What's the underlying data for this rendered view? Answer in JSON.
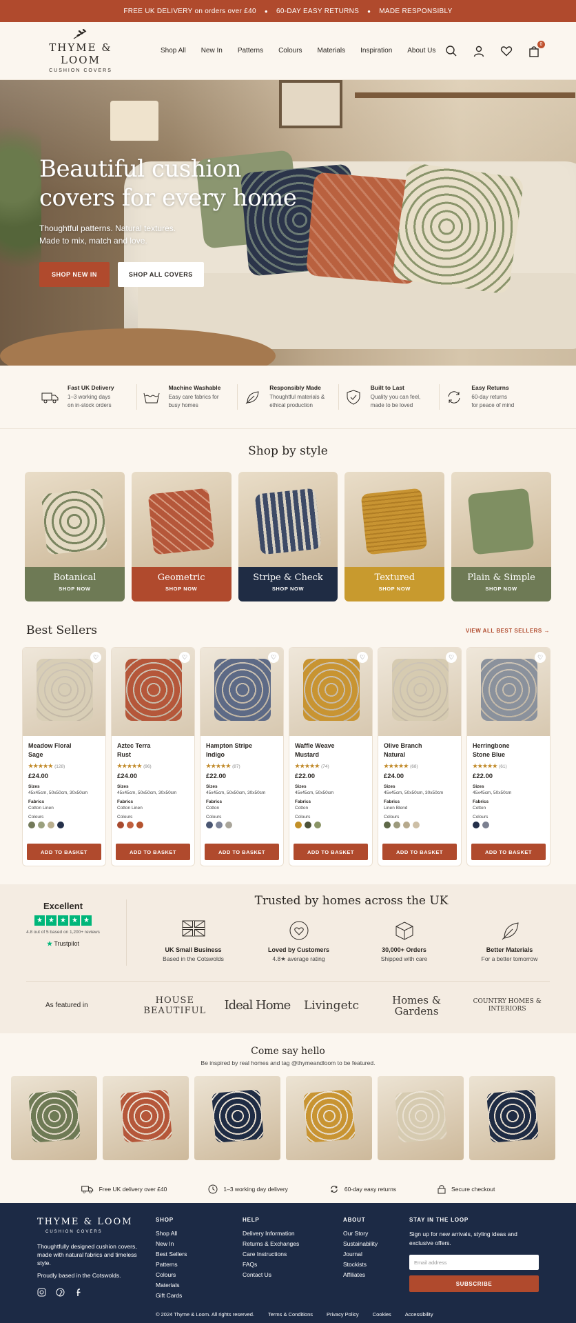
{
  "announcement": {
    "items": [
      "FREE UK DELIVERY on orders over £40",
      "60-DAY EASY RETURNS",
      "MADE RESPONSIBLY"
    ]
  },
  "brand": {
    "name": "THYME & LOOM",
    "tagline": "CUSHION COVERS"
  },
  "nav": [
    "Shop All",
    "New In",
    "Patterns",
    "Colours",
    "Materials",
    "Inspiration",
    "About Us"
  ],
  "header_icons": {
    "search": "search-icon",
    "account": "user-icon",
    "wishlist": "heart-icon",
    "basket": "bag-icon",
    "basket_count": "0"
  },
  "hero": {
    "title_line1": "Beautiful cushion",
    "title_line2": "covers for every home",
    "subtitle_line1": "Thoughtful patterns. Natural textures.",
    "subtitle_line2": "Made to mix, match and love.",
    "primary_cta": "SHOP NEW IN",
    "secondary_cta": "SHOP ALL COVERS"
  },
  "features": [
    {
      "icon": "truck-icon",
      "title": "Fast UK Delivery",
      "line1": "1–3 working days",
      "line2": "on in-stock orders"
    },
    {
      "icon": "wash-icon",
      "title": "Machine Washable",
      "line1": "Easy care fabrics for",
      "line2": "busy homes"
    },
    {
      "icon": "leaf-icon",
      "title": "Responsibly Made",
      "line1": "Thoughtful materials &",
      "line2": "ethical production"
    },
    {
      "icon": "shield-icon",
      "title": "Built to Last",
      "line1": "Quality you can feel,",
      "line2": "made to be loved"
    },
    {
      "icon": "returns-icon",
      "title": "Easy Returns",
      "line1": "60-day returns",
      "line2": "for peace of mind"
    }
  ],
  "shop_by_style": {
    "title": "Shop by style",
    "items": [
      {
        "name": "Botanical",
        "cta": "SHOP NOW",
        "color": "#6e7a55",
        "pillow": "#d9cfb6"
      },
      {
        "name": "Geometric",
        "cta": "SHOP NOW",
        "color": "#b04a2d",
        "pillow": "#b5573a"
      },
      {
        "name": "Stripe & Check",
        "cta": "SHOP NOW",
        "color": "#1f2c44",
        "pillow": "#6b7890"
      },
      {
        "name": "Textured",
        "cta": "SHOP NOW",
        "color": "#c89a2e",
        "pillow": "#c89432"
      },
      {
        "name": "Plain & Simple",
        "cta": "SHOP NOW",
        "color": "#6e7a55",
        "pillow": "#7f8f62"
      }
    ]
  },
  "best_sellers": {
    "title": "Best Sellers",
    "view_all": "VIEW ALL BEST SELLERS →",
    "sizes_label": "Sizes",
    "fabrics_label": "Fabrics",
    "colours_label": "Colours",
    "cta": "ADD TO BASKET",
    "products": [
      {
        "name1": "Meadow Floral",
        "name2": "Sage",
        "stars": "★★★★★",
        "reviews": "(128)",
        "price": "£24.00",
        "sizes": "45x45cm, 50x50cm, 30x50cm",
        "fabric": "Cotton Linen",
        "swatches": [
          "#737a5a",
          "#9aa07e",
          "#b9ae8e",
          "#24304a"
        ],
        "pillow": "#d8ceb6"
      },
      {
        "name1": "Aztec Terra",
        "name2": "Rust",
        "stars": "★★★★★",
        "reviews": "(96)",
        "price": "£24.00",
        "sizes": "45x45cm, 50x50cm, 30x50cm",
        "fabric": "Cotton Linen",
        "swatches": [
          "#a84a2f",
          "#c0603f",
          "#b5542f"
        ],
        "pillow": "#b5573a"
      },
      {
        "name1": "Hampton Stripe",
        "name2": "Indigo",
        "stars": "★★★★★",
        "reviews": "(87)",
        "price": "£22.00",
        "sizes": "45x45cm, 50x50cm, 30x50cm",
        "fabric": "Cotton",
        "swatches": [
          "#4a5672",
          "#7d8498",
          "#a9a59a"
        ],
        "pillow": "#5d6a86"
      },
      {
        "name1": "Waffle Weave",
        "name2": "Mustard",
        "stars": "★★★★★",
        "reviews": "(74)",
        "price": "£22.00",
        "sizes": "45x45cm, 50x50cm",
        "fabric": "Cotton",
        "swatches": [
          "#c29028",
          "#4c5238",
          "#8a9466"
        ],
        "pillow": "#c89432"
      },
      {
        "name1": "Olive Branch",
        "name2": "Natural",
        "stars": "★★★★★",
        "reviews": "(68)",
        "price": "£24.00",
        "sizes": "45x45cm, 50x50cm, 30x50cm",
        "fabric": "Linen Blend",
        "swatches": [
          "#5e6848",
          "#9c9a7c",
          "#b6a98c",
          "#cdbfa6"
        ],
        "pillow": "#d6cbb1"
      },
      {
        "name1": "Herringbone",
        "name2": "Stone Blue",
        "stars": "★★★★★",
        "reviews": "(61)",
        "price": "£22.00",
        "sizes": "45x45cm, 50x50cm",
        "fabric": "Cotton",
        "swatches": [
          "#24304a",
          "#7b8090"
        ],
        "pillow": "#8a919c"
      }
    ]
  },
  "trust": {
    "rating_word": "Excellent",
    "review_text": "4.8 out of 5 based on 1,200+ reviews",
    "trustpilot": "Trustpilot",
    "title": "Trusted by homes across the UK",
    "badges": [
      {
        "icon": "union-jack-icon",
        "title": "UK Small Business",
        "desc": "Based in the Cotswolds"
      },
      {
        "icon": "heart-icon",
        "title": "Loved by Customers",
        "desc": "4.8★ average rating"
      },
      {
        "icon": "box-icon",
        "title": "30,000+ Orders",
        "desc": "Shipped with care"
      },
      {
        "icon": "leaf-icon",
        "title": "Better Materials",
        "desc": "For a better tomorrow"
      }
    ],
    "featured_label": "As featured in",
    "press": [
      "HOUSE BEAUTIFUL",
      "Ideal Home",
      "Livingetc",
      "Homes & Gardens",
      "COUNTRY HOMES & INTERIORS"
    ]
  },
  "hello": {
    "title": "Come say hello",
    "desc": "Be inspired by real homes and tag @thymeandloom to be featured.",
    "images": [
      "#6e7a55",
      "#b5573a",
      "#1f2c44",
      "#c89432",
      "#d6cbb1",
      "#1f2c44"
    ]
  },
  "perks": [
    {
      "icon": "truck-icon",
      "label": "Free UK delivery over £40"
    },
    {
      "icon": "clock-icon",
      "label": "1–3 working day delivery"
    },
    {
      "icon": "returns-icon",
      "label": "60-day easy returns"
    },
    {
      "icon": "lock-icon",
      "label": "Secure checkout"
    }
  ],
  "footer": {
    "brand": "THYME & LOOM",
    "tagline": "CUSHION COVERS",
    "desc": "Thoughtfully designed cushion covers, made with natural fabrics and timeless style.",
    "based": "Proudly based in the Cotswolds.",
    "social": [
      "instagram-icon",
      "pinterest-icon",
      "facebook-icon"
    ],
    "shop_h": "SHOP",
    "shop": [
      "Shop All",
      "New In",
      "Best Sellers",
      "Patterns",
      "Colours",
      "Materials",
      "Gift Cards"
    ],
    "help_h": "HELP",
    "help": [
      "Delivery Information",
      "Returns & Exchanges",
      "Care Instructions",
      "FAQs",
      "Contact Us"
    ],
    "about_h": "ABOUT",
    "about": [
      "Our Story",
      "Sustainability",
      "Journal",
      "Stockists",
      "Affiliates"
    ],
    "news_h": "STAY IN THE LOOP",
    "news_desc": "Sign up for new arrivals, styling ideas and exclusive offers.",
    "email_placeholder": "Email address",
    "subscribe": "SUBSCRIBE",
    "copyright": "© 2024 Thyme & Loom. All rights reserved.",
    "legal": [
      "Terms & Conditions",
      "Privacy Policy",
      "Cookies",
      "Accessibility"
    ]
  },
  "colors": {
    "accent": "#b04a2d",
    "navy": "#1c2a45",
    "cream": "#fbf6ef",
    "trustpilot": "#00b67a"
  }
}
